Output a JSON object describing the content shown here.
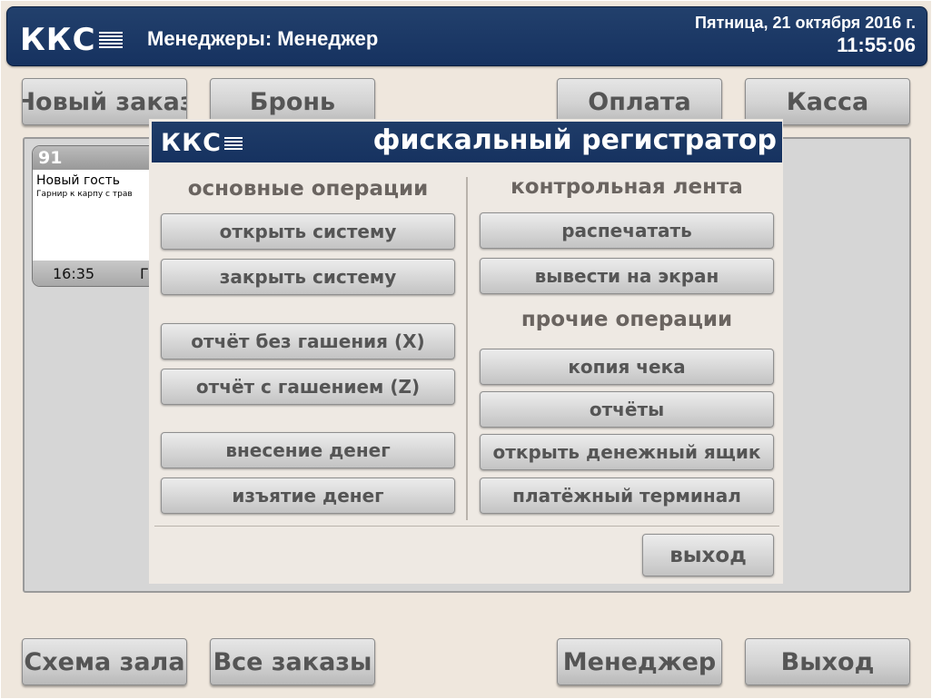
{
  "header": {
    "logo": "ККС",
    "title": "Менеджеры: Менеджер",
    "date": "Пятница, 21 октября 2016 г.",
    "time": "11:55:06"
  },
  "top_nav": {
    "new_order": "Новый заказ",
    "reservation": "Бронь",
    "payment": "Оплата",
    "cash": "Касса"
  },
  "bottom_nav": {
    "hall_scheme": "Схема зала",
    "all_orders": "Все заказы",
    "manager": "Менеджер",
    "exit": "Выход"
  },
  "order_card": {
    "number": "91",
    "guest": "Новый гость",
    "dish": "Гарнир к карпу с трав",
    "time": "16:35",
    "extra": "Г"
  },
  "dialog": {
    "logo": "ККС",
    "title": "фискальный регистратор",
    "main_ops": {
      "heading": "основные операции",
      "open_system": "открыть систему",
      "close_system": "закрыть систему",
      "x_report": "отчёт без гашения (X)",
      "z_report": "отчёт с гашением (Z)",
      "cash_in": "внесение денег",
      "cash_out": "изъятие денег"
    },
    "control_tape": {
      "heading": "контрольная лента",
      "print": "распечатать",
      "show_on_screen": "вывести на экран"
    },
    "other_ops": {
      "heading": "прочие операции",
      "receipt_copy": "копия чека",
      "reports": "отчёты",
      "open_drawer": "открыть денежный ящик",
      "payment_terminal": "платёжный терминал"
    },
    "exit": "выход"
  }
}
